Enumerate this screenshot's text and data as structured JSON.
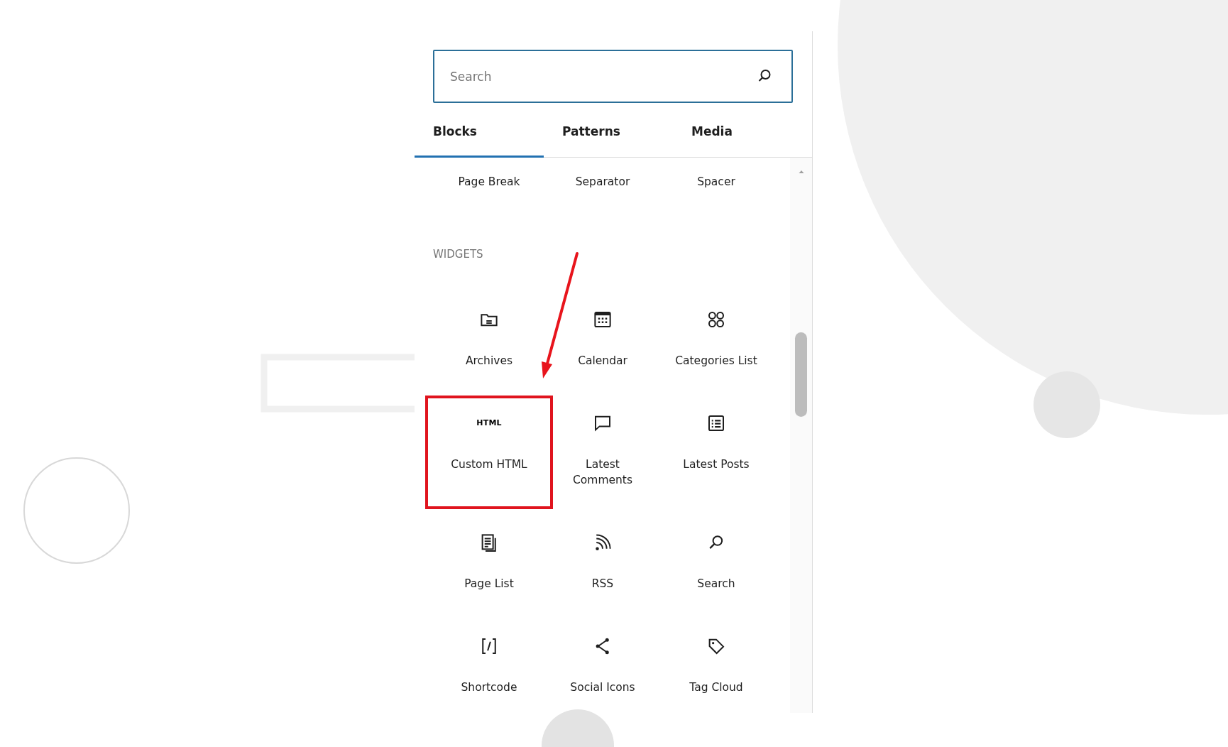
{
  "search": {
    "placeholder": "Search"
  },
  "tabs": [
    {
      "label": "Blocks",
      "selected": true
    },
    {
      "label": "Patterns",
      "selected": false
    },
    {
      "label": "Media",
      "selected": false
    }
  ],
  "scrolled_blocks": [
    {
      "label": "Page Break"
    },
    {
      "label": "Separator"
    },
    {
      "label": "Spacer"
    }
  ],
  "section": {
    "title": "WIDGETS",
    "blocks": [
      {
        "kind": "folder",
        "label": "Archives",
        "highlighted": false
      },
      {
        "kind": "calendar",
        "label": "Calendar",
        "highlighted": false
      },
      {
        "kind": "circles",
        "label": "Categories List",
        "highlighted": false
      },
      {
        "kind": "text",
        "icon_text": "HTML",
        "label": "Custom HTML",
        "highlighted": true
      },
      {
        "kind": "speech",
        "label": "Latest Comments",
        "highlighted": false
      },
      {
        "kind": "list",
        "label": "Latest Posts",
        "highlighted": false
      },
      {
        "kind": "pages",
        "label": "Page List",
        "highlighted": false
      },
      {
        "kind": "feed",
        "label": "RSS",
        "highlighted": false
      },
      {
        "kind": "search",
        "label": "Search",
        "highlighted": false
      },
      {
        "kind": "shortcode",
        "label": "Shortcode",
        "highlighted": false
      },
      {
        "kind": "share",
        "label": "Social Icons",
        "highlighted": false
      },
      {
        "kind": "tag",
        "label": "Tag Cloud",
        "highlighted": false
      }
    ]
  }
}
